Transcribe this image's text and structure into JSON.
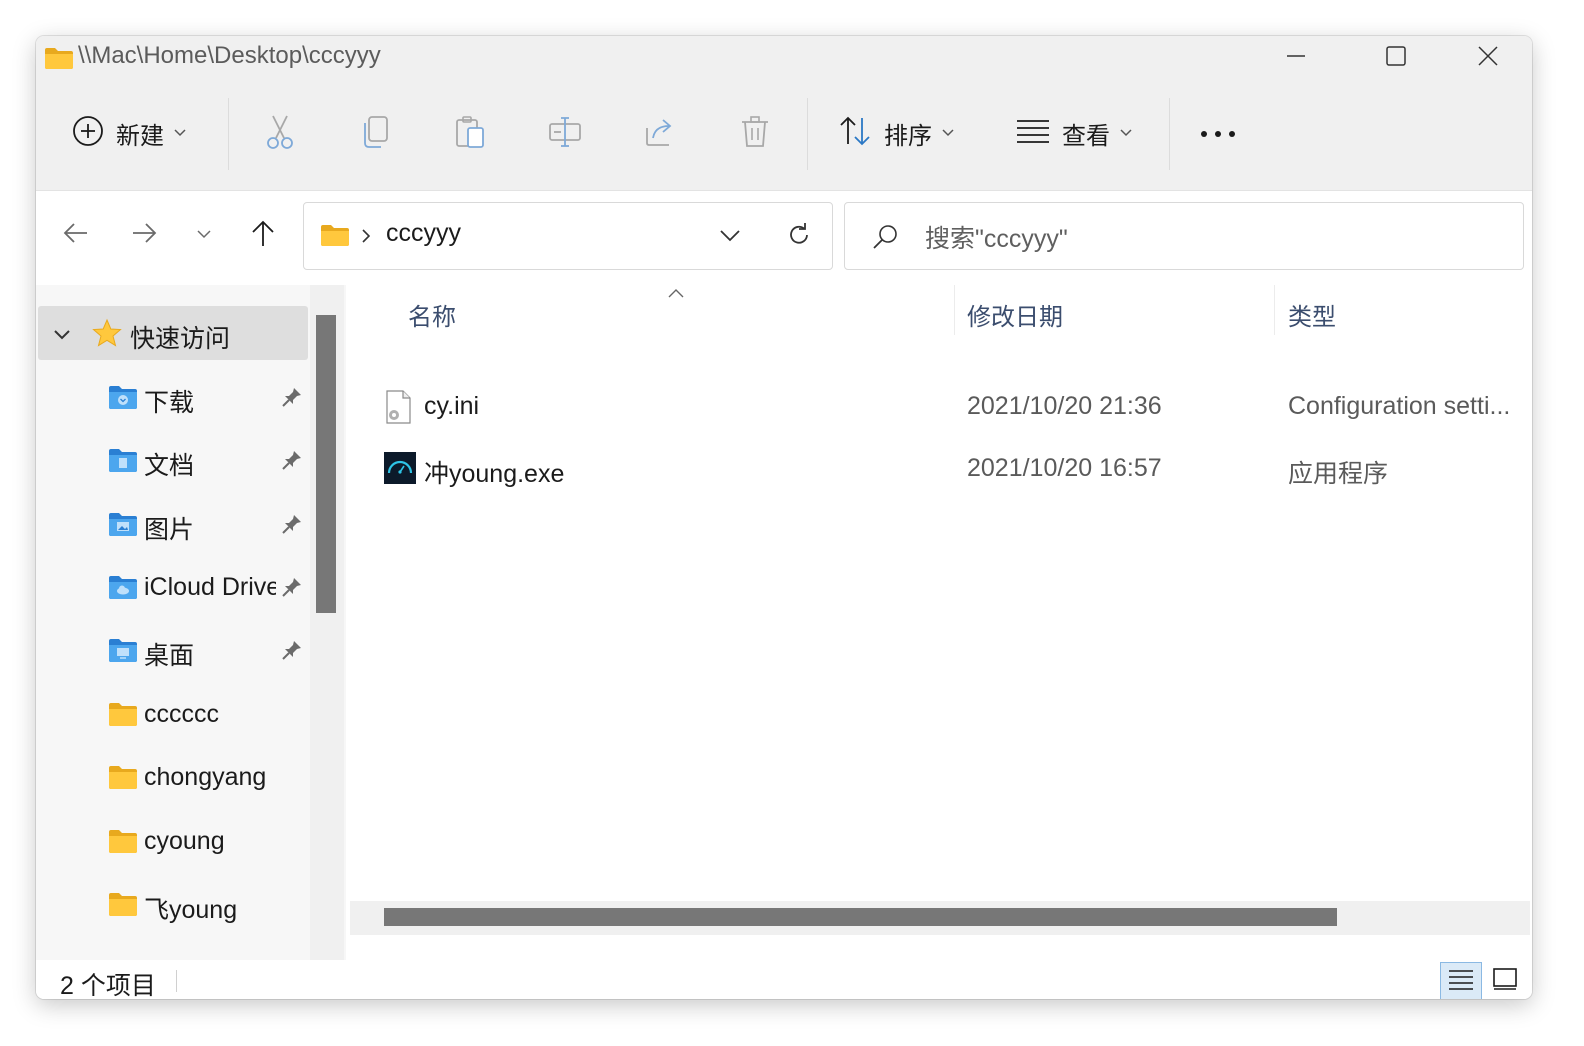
{
  "window": {
    "title": "\\\\Mac\\Home\\Desktop\\cccyyy"
  },
  "toolbar": {
    "new_label": "新建",
    "sort_label": "排序",
    "view_label": "查看",
    "icons": [
      "plus-circle-icon",
      "cut-icon",
      "copy-icon",
      "paste-icon",
      "rename-icon",
      "share-icon",
      "delete-icon",
      "sort-icon",
      "view-list-icon",
      "more-icon"
    ]
  },
  "address": {
    "folder": "cccyyy"
  },
  "search": {
    "placeholder": "搜索\"cccyyy\""
  },
  "sidebar": {
    "quick_access": "快速访问",
    "items": [
      {
        "label": "下载",
        "pinned": true,
        "icon": "download-folder-icon"
      },
      {
        "label": "文档",
        "pinned": true,
        "icon": "documents-folder-icon"
      },
      {
        "label": "图片",
        "pinned": true,
        "icon": "pictures-folder-icon"
      },
      {
        "label": "iCloud Drive",
        "pinned": true,
        "icon": "icloud-folder-icon"
      },
      {
        "label": "桌面",
        "pinned": true,
        "icon": "desktop-folder-icon"
      },
      {
        "label": "cccccc",
        "pinned": false,
        "icon": "folder-icon"
      },
      {
        "label": "chongyang",
        "pinned": false,
        "icon": "folder-icon"
      },
      {
        "label": "cyoung",
        "pinned": false,
        "icon": "folder-icon"
      },
      {
        "label": "飞young",
        "pinned": false,
        "icon": "folder-icon"
      }
    ]
  },
  "columns": {
    "name": "名称",
    "date": "修改日期",
    "type": "类型"
  },
  "files": [
    {
      "name": "cy.ini",
      "date": "2021/10/20 21:36",
      "type": "Configuration setti...",
      "icon": "ini-file-icon"
    },
    {
      "name": "冲young.exe",
      "date": "2021/10/20 16:57",
      "type": "应用程序",
      "icon": "exe-app-icon"
    }
  ],
  "status": {
    "count": "2 个项目"
  },
  "colors": {
    "chrome": "#f0f0f0",
    "folder_yellow": "#ffc83d",
    "folder_blue": "#3b9be8",
    "scroll_thumb": "#777777",
    "header_text": "#3b4d6e"
  }
}
